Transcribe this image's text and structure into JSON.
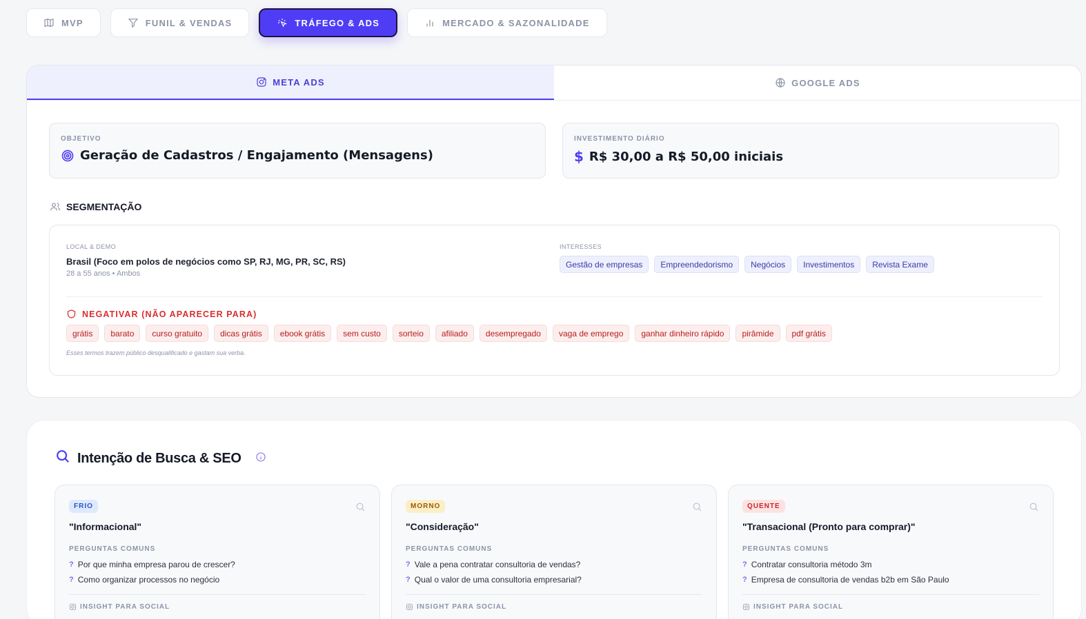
{
  "topnav": [
    {
      "label": "MVP",
      "icon": "map-icon",
      "active": false
    },
    {
      "label": "FUNIL & VENDAS",
      "icon": "filter-icon",
      "active": false
    },
    {
      "label": "TRÁFEGO & ADS",
      "icon": "sparkle-cursor-icon",
      "active": true
    },
    {
      "label": "MERCADO & SAZONALIDADE",
      "icon": "bar-chart-icon",
      "active": false
    }
  ],
  "ads": {
    "tabs": [
      {
        "label": "META ADS",
        "icon": "instagram-icon",
        "active": true
      },
      {
        "label": "GOOGLE ADS",
        "icon": "globe-icon",
        "active": false
      }
    ],
    "objective": {
      "label": "OBJETIVO",
      "value": "Geração de Cadastros / Engajamento (Mensagens)",
      "icon": "target-icon"
    },
    "investment": {
      "label": "INVESTIMENTO DIÁRIO",
      "value": "R$ 30,00 a R$ 50,00 iniciais",
      "icon": "dollar-icon",
      "symbol": "$"
    },
    "segmentation": {
      "title": "SEGMENTAÇÃO",
      "local_label": "LOCAL & DEMO",
      "local_value": "Brasil (Foco em polos de negócios como SP, RJ, MG, PR, SC, RS)",
      "local_sub": "28 a 55 anos • Ambos",
      "interests_label": "INTERESSES",
      "interests": [
        "Gestão de empresas",
        "Empreendedorismo",
        "Negócios",
        "Investimentos",
        "Revista Exame"
      ],
      "negative_title": "NEGATIVAR (NÃO APARECER PARA)",
      "negatives": [
        "grátis",
        "barato",
        "curso gratuito",
        "dicas grátis",
        "ebook grátis",
        "sem custo",
        "sorteio",
        "afiliado",
        "desempregado",
        "vaga de emprego",
        "ganhar dinheiro rápido",
        "pirâmide",
        "pdf grátis"
      ],
      "negative_note": "Esses termos trazem público desqualificado e gastam sua verba."
    }
  },
  "seo": {
    "title": "Intenção de Busca & SEO",
    "cards": [
      {
        "badge": "FRIO",
        "title": "\"Informacional\"",
        "questions_label": "PERGUNTAS COMUNS",
        "questions": [
          "Por que minha empresa parou de crescer?",
          "Como organizar processos no negócio"
        ],
        "insight_label": "INSIGHT PARA SOCIAL"
      },
      {
        "badge": "MORNO",
        "title": "\"Consideração\"",
        "questions_label": "PERGUNTAS COMUNS",
        "questions": [
          "Vale a pena contratar consultoria de vendas?",
          "Qual o valor de uma consultoria empresarial?"
        ],
        "insight_label": "INSIGHT PARA SOCIAL"
      },
      {
        "badge": "QUENTE",
        "title": "\"Transacional (Pronto para comprar)\"",
        "questions_label": "PERGUNTAS COMUNS",
        "questions": [
          "Contratar consultoria método 3m",
          "Empresa de consultoria de vendas b2b em São Paulo"
        ],
        "insight_label": "INSIGHT PARA SOCIAL"
      }
    ]
  }
}
